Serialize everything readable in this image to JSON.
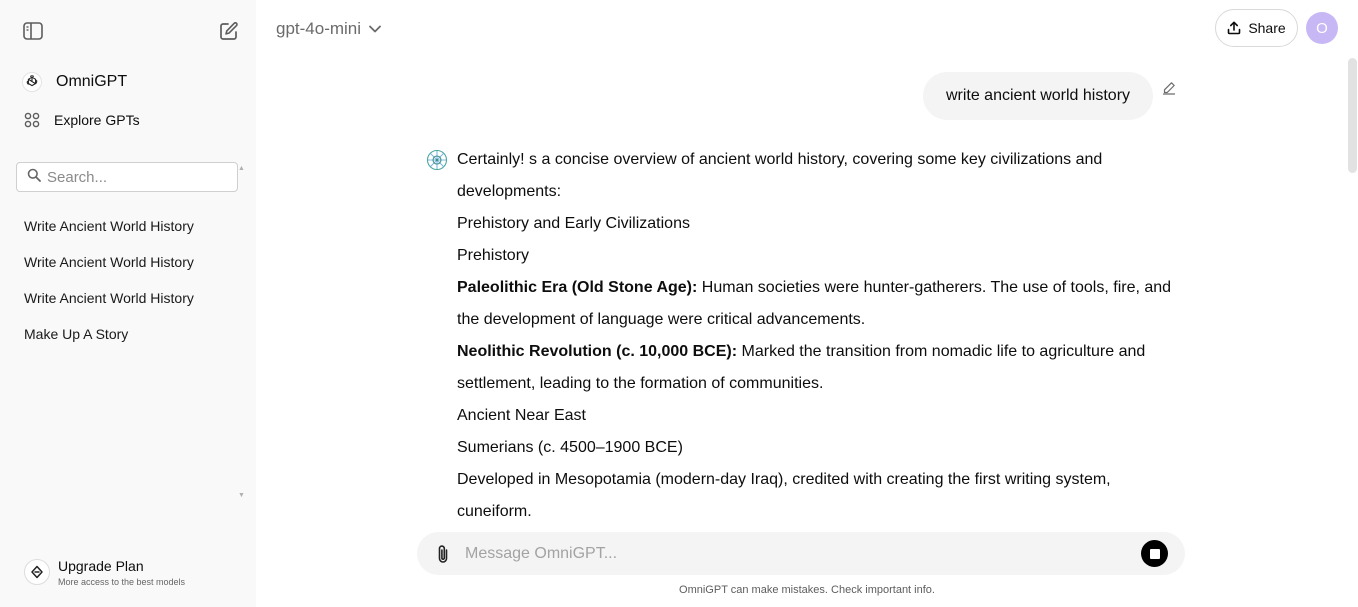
{
  "sidebar": {
    "brand_label": "OmniGPT",
    "explore_label": "Explore GPTs",
    "search_placeholder": "Search...",
    "history": [
      {
        "label": "Write Ancient World History"
      },
      {
        "label": "Write Ancient World History"
      },
      {
        "label": "Write Ancient World History"
      },
      {
        "label": "Make Up A Story"
      }
    ],
    "upgrade": {
      "title": "Upgrade Plan",
      "subtitle": "More access to the best models"
    }
  },
  "header": {
    "model_name": "gpt-4o-mini",
    "share_label": "Share",
    "avatar_initial": "O"
  },
  "conversation": {
    "user_message": "write ancient world history",
    "answer": {
      "intro": "Certainly! s a concise overview of ancient world history, covering some key civilizations and developments:",
      "h1": "Prehistory and Early Civilizations",
      "h2": "Prehistory",
      "p1_bold": "Paleolithic Era (Old Stone Age):",
      "p1_text": " Human societies were hunter-gatherers. The use of tools, fire, and the development of language were critical advancements.",
      "p2_bold": "Neolithic Revolution (c. 10,000 BCE):",
      "p2_text": " Marked the transition from nomadic life to agriculture and settlement, leading to the formation of communities.",
      "h3": "Ancient Near East",
      "h4": "Sumerians (c. 4500–1900 BCE)",
      "p3": "Developed in Mesopotamia (modern-day Iraq), credited with creating the first writing system, cuneiform."
    }
  },
  "composer": {
    "placeholder": "Message OmniGPT...",
    "disclaimer": "OmniGPT can make mistakes. Check important info."
  },
  "colors": {
    "sidebar_bg": "#f9f9f9",
    "bubble_bg": "#f4f4f4",
    "avatar_bg": "#c7b8f5"
  }
}
